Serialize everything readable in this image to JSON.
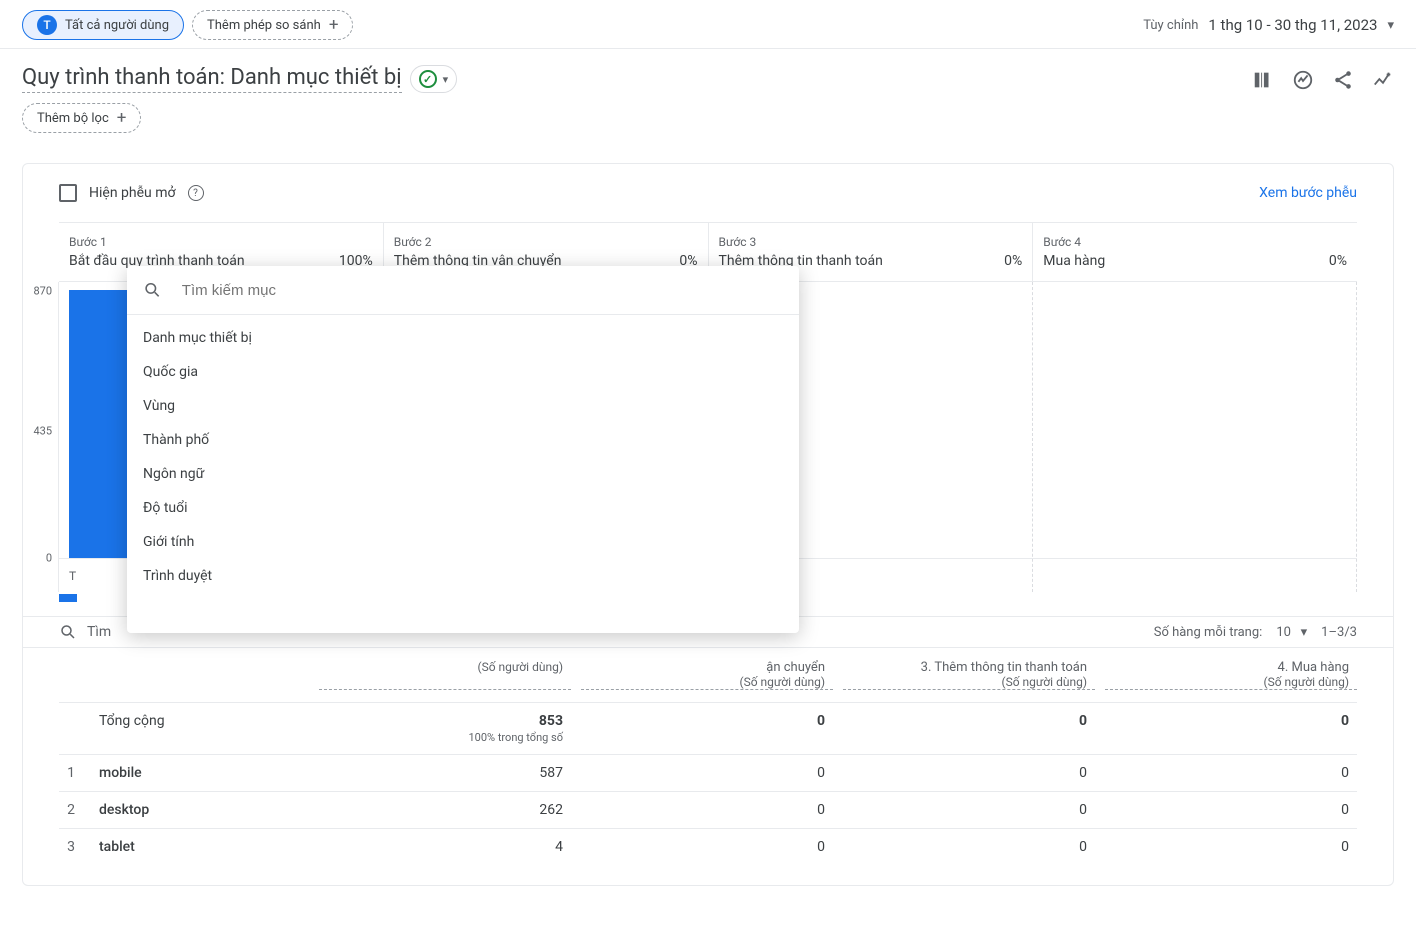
{
  "topbar": {
    "all_users_label": "Tất cả người dùng",
    "chip_icon_text": "T",
    "add_comparison_label": "Thêm phép so sánh",
    "date_mode_label": "Tùy chỉnh",
    "date_range": "1 thg 10 - 30 thg 11, 2023"
  },
  "header": {
    "page_title": "Quy trình thanh toán: Danh mục thiết bị",
    "add_filter_label": "Thêm bộ lọc"
  },
  "card": {
    "open_funnel_label": "Hiện phễu mở",
    "view_funnel_steps": "Xem bước phễu"
  },
  "funnel_steps": [
    {
      "label": "Bước 1",
      "name": "Bắt đầu quy trình thanh toán",
      "pct": "100%"
    },
    {
      "label": "Bước 2",
      "name": "Thêm thông tin vận chuyển",
      "pct": "0%"
    },
    {
      "label": "Bước 3",
      "name": "Thêm thông tin thanh toán",
      "pct": "0%"
    },
    {
      "label": "Bước 4",
      "name": "Mua hàng",
      "pct": "0%"
    }
  ],
  "chart_data": {
    "type": "bar",
    "categories": [
      "Bắt đầu quy trình thanh toán",
      "Thêm thông tin vận chuyển",
      "Thêm thông tin thanh toán",
      "Mua hàng"
    ],
    "values": [
      853,
      0,
      0,
      0
    ],
    "ylim": [
      0,
      870
    ],
    "y_ticks": [
      0,
      435,
      870
    ],
    "visible_x_fragment": "ận chuyển"
  },
  "table_controls": {
    "search_placeholder": "Tìm",
    "rows_per_page_label": "Số hàng mỗi trang:",
    "rows_per_page_value": "10",
    "page_range": "1–3/3"
  },
  "table": {
    "total_label": "Tổng cộng",
    "columns": [
      {
        "title": "",
        "sub": "(Số người dùng)"
      },
      {
        "title": "ận chuyển",
        "sub": "(Số người dùng)"
      },
      {
        "title": "3. Thêm thông tin thanh toán",
        "sub": "(Số người dùng)"
      },
      {
        "title": "4. Mua hàng",
        "sub": "(Số người dùng)"
      }
    ],
    "total_row": {
      "step1": "853",
      "step1_sub": "100% trong tổng số",
      "step2": "0",
      "step3": "0",
      "step4": "0"
    },
    "rows": [
      {
        "idx": "1",
        "cat": "mobile",
        "v": [
          "587",
          "0",
          "0",
          "0"
        ]
      },
      {
        "idx": "2",
        "cat": "desktop",
        "v": [
          "262",
          "0",
          "0",
          "0"
        ]
      },
      {
        "idx": "3",
        "cat": "tablet",
        "v": [
          "4",
          "0",
          "0",
          "0"
        ]
      }
    ]
  },
  "popover": {
    "search_placeholder": "Tìm kiếm mục",
    "items": [
      "Danh mục thiết bị",
      "Quốc gia",
      "Vùng",
      "Thành phố",
      "Ngôn ngữ",
      "Độ tuổi",
      "Giới tính",
      "Trình duyệt"
    ]
  }
}
